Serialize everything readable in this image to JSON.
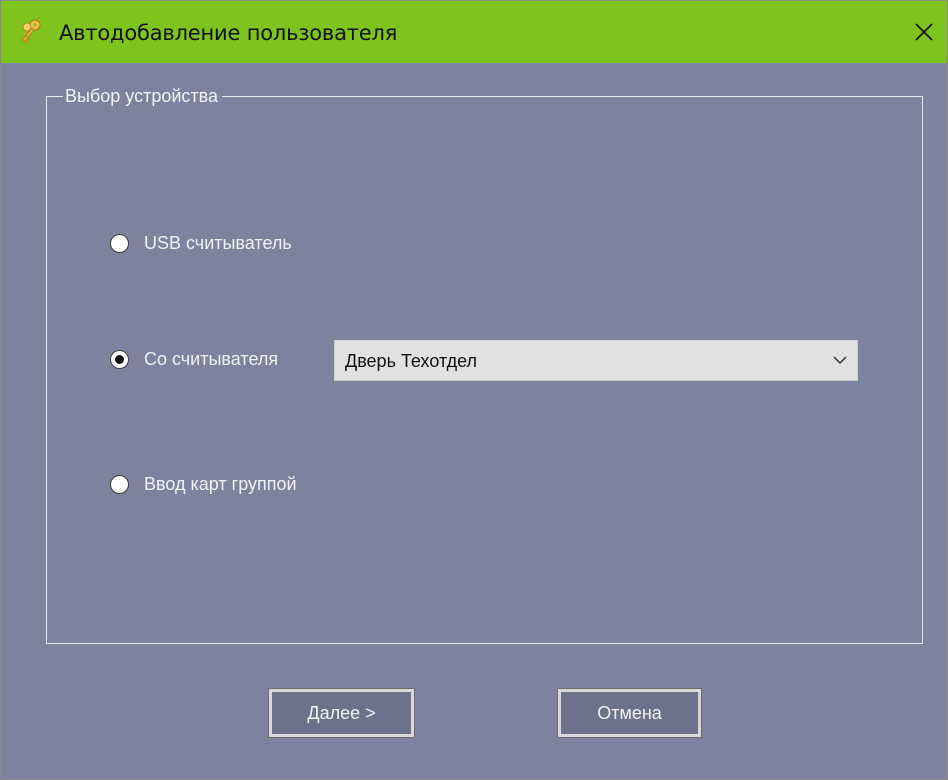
{
  "window": {
    "title": "Автодобавление пользователя",
    "titlebar_color": "#7fc31f",
    "background_color": "#7d829e",
    "icon": "key-icon"
  },
  "group": {
    "legend": "Выбор устройства"
  },
  "options": [
    {
      "label": "USB считыватель",
      "checked": false
    },
    {
      "label": "Со считывателя",
      "checked": true
    },
    {
      "label": "Ввод карт группой",
      "checked": false
    }
  ],
  "reader_select": {
    "value": "Дверь Техотдел",
    "icon": "chevron-down-icon"
  },
  "buttons": {
    "next": "Далее >",
    "cancel": "Отмена"
  },
  "close_icon": "close-icon"
}
